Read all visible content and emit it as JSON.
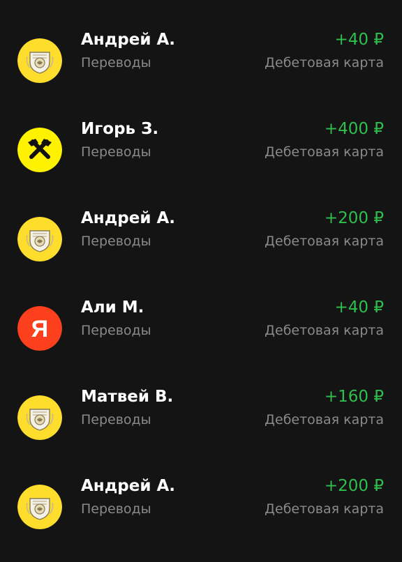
{
  "colors": {
    "background": "#141414",
    "positive_amount": "#2fbf4c",
    "secondary_text": "#8a8a8a",
    "tinkoff_yellow": "#ffdd2d",
    "raiffeisen_yellow": "#fff200",
    "yandex_red": "#fc3f1d"
  },
  "transactions": [
    {
      "name": "Андрей А.",
      "category": "Переводы",
      "amount": "+40 ₽",
      "account": "Дебетовая карта",
      "bank_icon": "tinkoff-bank-icon"
    },
    {
      "name": "Игорь З.",
      "category": "Переводы",
      "amount": "+400 ₽",
      "account": "Дебетовая карта",
      "bank_icon": "raiffeisen-bank-icon"
    },
    {
      "name": "Андрей А.",
      "category": "Переводы",
      "amount": "+200 ₽",
      "account": "Дебетовая карта",
      "bank_icon": "tinkoff-bank-icon"
    },
    {
      "name": "Али М.",
      "category": "Переводы",
      "amount": "+40 ₽",
      "account": "Дебетовая карта",
      "bank_icon": "yandex-bank-icon",
      "bank_letter": "Я"
    },
    {
      "name": "Матвей В.",
      "category": "Переводы",
      "amount": "+160 ₽",
      "account": "Дебетовая карта",
      "bank_icon": "tinkoff-bank-icon"
    },
    {
      "name": "Андрей А.",
      "category": "Переводы",
      "amount": "+200 ₽",
      "account": "Дебетовая карта",
      "bank_icon": "tinkoff-bank-icon"
    }
  ]
}
